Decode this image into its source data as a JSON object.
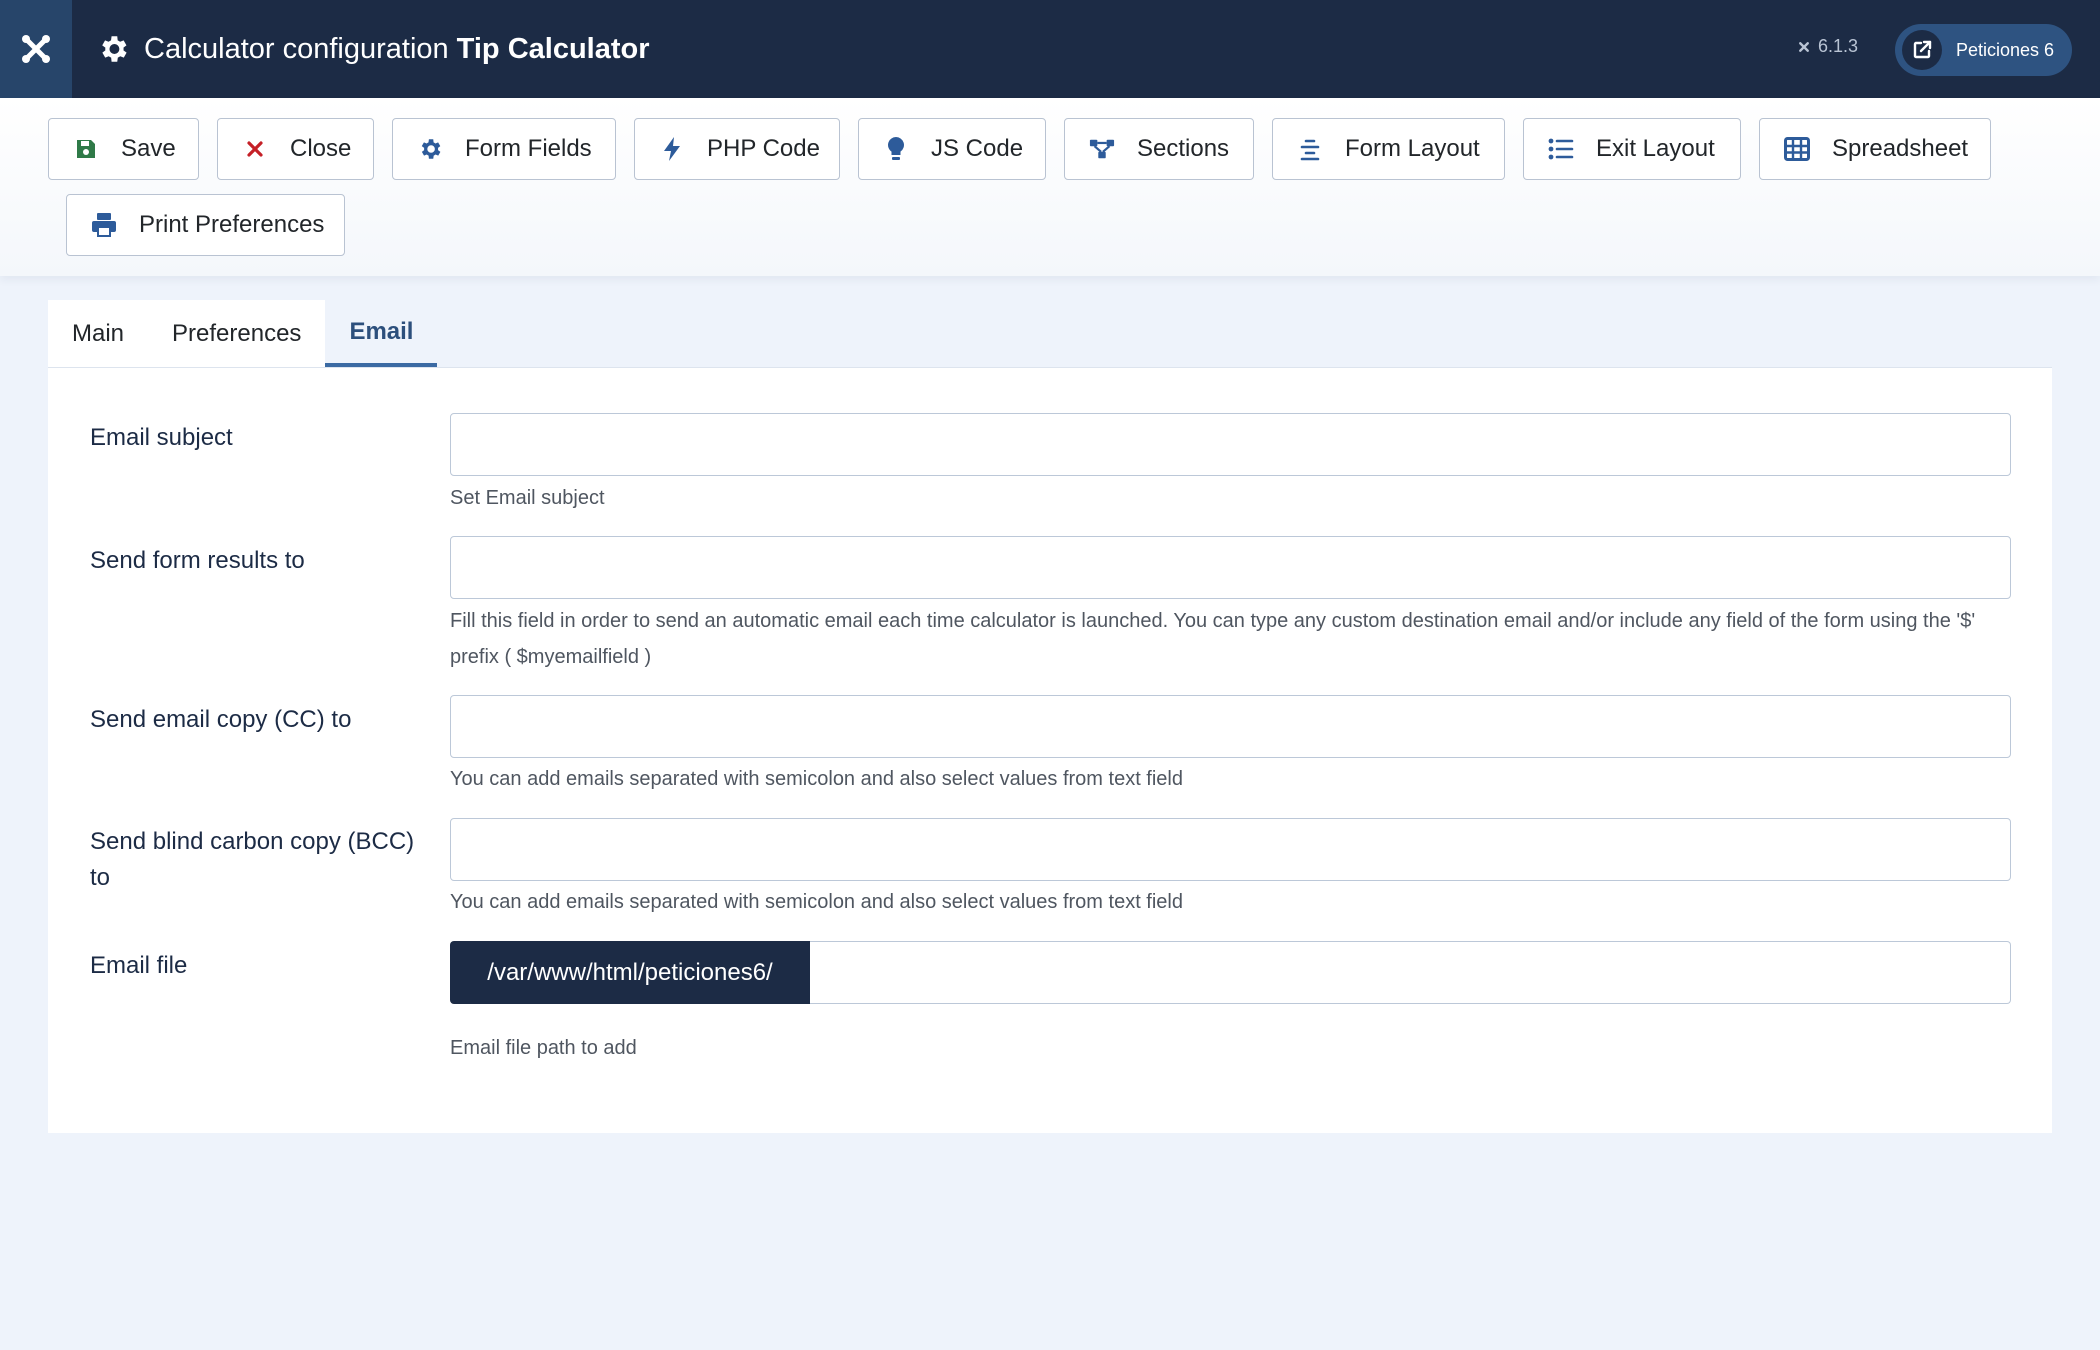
{
  "header": {
    "title_prefix": "Calculator configuration",
    "title_name": "Tip Calculator",
    "version": "6.1.3",
    "site_button_label": "Peticiones 6"
  },
  "toolbar": {
    "buttons": [
      {
        "label": "Save",
        "icon": "save-icon"
      },
      {
        "label": "Close",
        "icon": "close-icon"
      },
      {
        "label": "Form Fields",
        "icon": "gear-icon"
      },
      {
        "label": "PHP Code",
        "icon": "bolt-icon"
      },
      {
        "label": "JS Code",
        "icon": "lightbulb-icon"
      },
      {
        "label": "Sections",
        "icon": "sitemap-icon"
      },
      {
        "label": "Form Layout",
        "icon": "align-center-icon"
      },
      {
        "label": "Exit Layout",
        "icon": "list-icon"
      },
      {
        "label": "Spreadsheet",
        "icon": "table-icon"
      },
      {
        "label": "Print Preferences",
        "icon": "print-icon"
      }
    ]
  },
  "tabs": [
    {
      "label": "Main"
    },
    {
      "label": "Preferences"
    },
    {
      "label": "Email",
      "active": true
    }
  ],
  "email_tab": {
    "email_subject": {
      "label": "Email subject",
      "value": "",
      "help": "Set Email subject"
    },
    "send_to": {
      "label": "Send form results to",
      "value": "",
      "help": "Fill this field in order to send an automatic email each time calculator is launched. You can type any custom destination email and/or include any field of the form using the '$' prefix ( $myemailfield )"
    },
    "cc": {
      "label": "Send email copy (CC) to",
      "value": "",
      "help": "You can add emails separated with semicolon and also select values from text field"
    },
    "bcc": {
      "label": "Send blind carbon copy (BCC) to",
      "value": "",
      "help": "You can add emails separated with semicolon and also select values from text field"
    },
    "email_file": {
      "label": "Email file",
      "prefix": "/var/www/html/peticiones6/",
      "value": "",
      "help": "Email file path to add"
    }
  },
  "colors": {
    "header_bg": "#1c2b45",
    "accent": "#2c4f7c",
    "green_icon": "#2f7a48",
    "red_icon": "#c52027",
    "blue_icon": "#2d5b9a"
  }
}
